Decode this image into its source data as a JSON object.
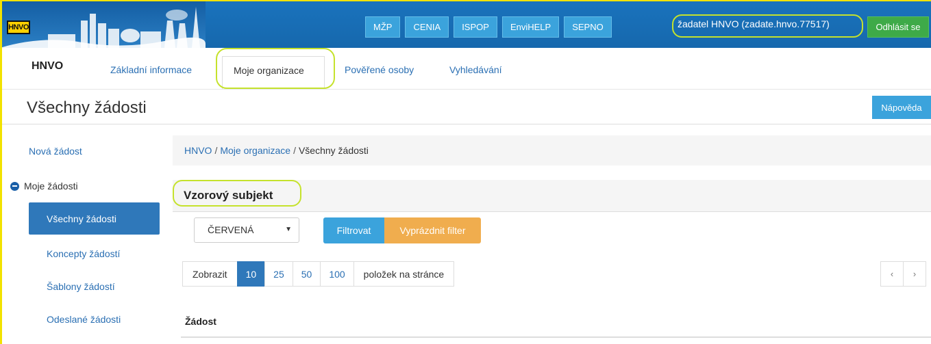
{
  "header": {
    "logo_text": "HNVO",
    "top_links": [
      "MŽP",
      "CENIA",
      "ISPOP",
      "EnviHELP",
      "SEPNO"
    ],
    "user_label": "žadatel HNVO (zadate.hnvo.77517)",
    "logout_label": "Odhlásit se"
  },
  "appnav": {
    "brand": "HNVO",
    "links": [
      "Základní informace",
      "Moje organizace",
      "Pověřené osoby",
      "Vyhledávání"
    ]
  },
  "page": {
    "title": "Všechny žádosti",
    "help_label": "Nápověda"
  },
  "sidebar": {
    "new_request": "Nová žádost",
    "group_label": "Moje žádosti",
    "items": [
      "Všechny žádosti",
      "Koncepty žádostí",
      "Šablony žádostí",
      "Odeslané žádosti"
    ]
  },
  "breadcrumb": {
    "root": "HNVO",
    "middle": "Moje organizace",
    "current": "Všechny žádosti"
  },
  "panel": {
    "title": "Vzorový subjekt",
    "filter_select_value": "ČERVENÁ",
    "filter_label": "Filtrovat",
    "clear_label": "Vyprázdnit filter"
  },
  "pager": {
    "show_label": "Zobrazit",
    "sizes": [
      "10",
      "25",
      "50",
      "100"
    ],
    "suffix": "položek na stránce",
    "prev": "‹",
    "next": "›"
  },
  "table": {
    "col_request": "Žádost"
  },
  "colors": {
    "banner": "#1a73bd",
    "accent_blue": "#2f78ba",
    "info": "#3ba3dc",
    "warning": "#f0ad4e",
    "success": "#3eaa48",
    "highlight_ring": "#c5e22c"
  }
}
